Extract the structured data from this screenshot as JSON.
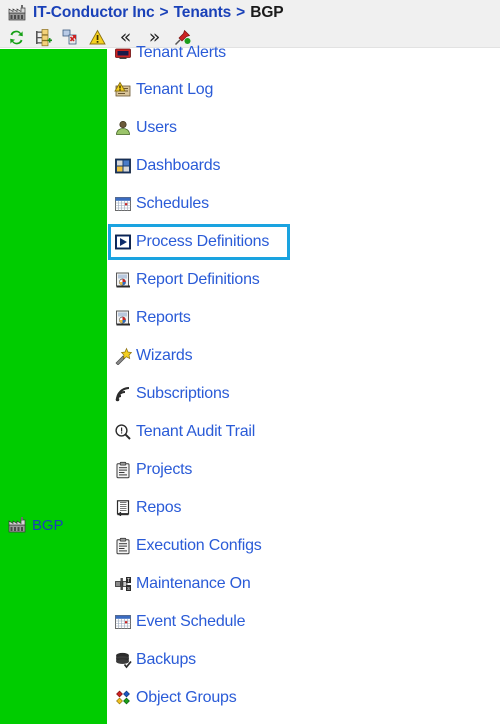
{
  "header": {
    "breadcrumb": {
      "icon": "factory-icon",
      "root": "IT-Conductor Inc",
      "separator": ">",
      "parent": "Tenants",
      "current": "BGP"
    },
    "toolbar": {
      "items": [
        {
          "name": "refresh-icon",
          "label": "Refresh"
        },
        {
          "name": "add-node-icon",
          "label": "Add"
        },
        {
          "name": "delete-node-icon",
          "label": "Delete"
        },
        {
          "name": "warning-icon",
          "label": "Alerts"
        },
        {
          "name": "collapse-all-icon",
          "label": "«"
        },
        {
          "name": "expand-all-icon",
          "label": "»"
        },
        {
          "name": "pin-icon",
          "label": "Pin"
        }
      ]
    },
    "colors": {
      "background": "#f0f0f0",
      "link": "#1a41b8",
      "current": "#1a1a1a"
    }
  },
  "sidebar": {
    "background_color": "#00cc00",
    "items": [
      {
        "icon": "factory-icon",
        "label": "BGP"
      }
    ]
  },
  "menu": {
    "selected_item": "Process Definitions",
    "selection_color": "#1aa3e0",
    "link_color": "#2a5bd7",
    "items": [
      {
        "icon": "tenant-alerts-icon",
        "label": "Tenant Alerts",
        "clipped": true
      },
      {
        "icon": "tenant-log-icon",
        "label": "Tenant Log",
        "clipped": false
      },
      {
        "icon": "users-icon",
        "label": "Users",
        "clipped": false
      },
      {
        "icon": "dashboards-icon",
        "label": "Dashboards",
        "clipped": false
      },
      {
        "icon": "schedules-icon",
        "label": "Schedules",
        "clipped": false
      },
      {
        "icon": "process-definitions-icon",
        "label": "Process Definitions",
        "clipped": false
      },
      {
        "icon": "report-definitions-icon",
        "label": "Report Definitions",
        "clipped": false
      },
      {
        "icon": "reports-icon",
        "label": "Reports",
        "clipped": false
      },
      {
        "icon": "wizards-icon",
        "label": "Wizards",
        "clipped": false
      },
      {
        "icon": "subscriptions-icon",
        "label": "Subscriptions",
        "clipped": false
      },
      {
        "icon": "tenant-audit-trail-icon",
        "label": "Tenant Audit Trail",
        "clipped": false
      },
      {
        "icon": "projects-icon",
        "label": "Projects",
        "clipped": false
      },
      {
        "icon": "repos-icon",
        "label": "Repos",
        "clipped": false
      },
      {
        "icon": "execution-configs-icon",
        "label": "Execution Configs",
        "clipped": false
      },
      {
        "icon": "maintenance-on-icon",
        "label": "Maintenance On",
        "clipped": false
      },
      {
        "icon": "event-schedule-icon",
        "label": "Event Schedule",
        "clipped": false
      },
      {
        "icon": "backups-icon",
        "label": "Backups",
        "clipped": false
      },
      {
        "icon": "object-groups-icon",
        "label": "Object Groups",
        "clipped": false
      }
    ]
  }
}
